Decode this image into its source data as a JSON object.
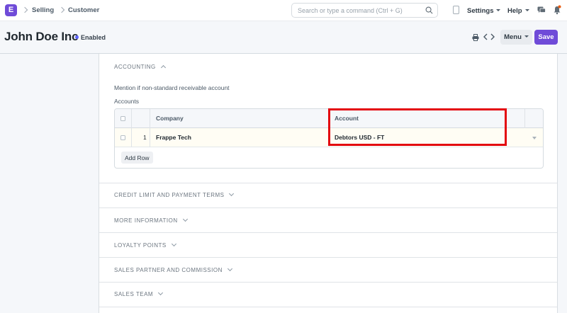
{
  "navbar": {
    "logo_letter": "E",
    "breadcrumbs": [
      "Selling",
      "Customer"
    ],
    "search_placeholder": "Search or type a command (Ctrl + G)",
    "settings_label": "Settings",
    "help_label": "Help"
  },
  "page": {
    "title": "John Doe Inc",
    "status": "Enabled",
    "status_color": "#5e64ff",
    "menu_label": "Menu",
    "save_label": "Save",
    "accent_color": "#6f4bd8"
  },
  "accounting": {
    "section_title": "ACCOUNTING",
    "description": "Mention if non-standard receivable account",
    "field_label": "Accounts",
    "table": {
      "columns": [
        "Company",
        "Account"
      ],
      "rows": [
        {
          "index": "1",
          "company": "Frappe Tech",
          "account": "Debtors USD - FT"
        }
      ],
      "add_row_label": "Add Row"
    }
  },
  "sections": [
    "CREDIT LIMIT AND PAYMENT TERMS",
    "MORE INFORMATION",
    "LOYALTY POINTS",
    "SALES PARTNER AND COMMISSION",
    "SALES TEAM"
  ],
  "highlight_color": "#e3070f"
}
